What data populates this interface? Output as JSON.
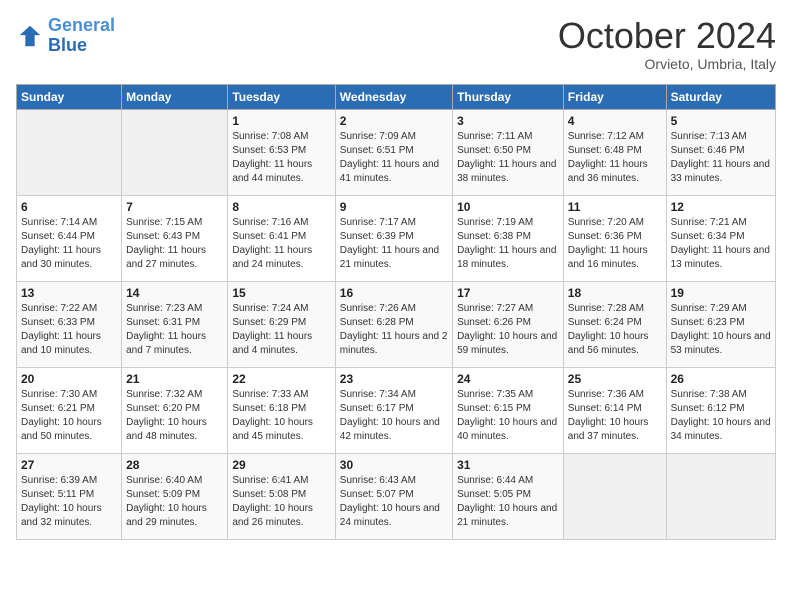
{
  "header": {
    "logo_line1": "General",
    "logo_line2": "Blue",
    "month": "October 2024",
    "location": "Orvieto, Umbria, Italy"
  },
  "weekdays": [
    "Sunday",
    "Monday",
    "Tuesday",
    "Wednesday",
    "Thursday",
    "Friday",
    "Saturday"
  ],
  "weeks": [
    [
      {
        "day": "",
        "info": ""
      },
      {
        "day": "",
        "info": ""
      },
      {
        "day": "1",
        "info": "Sunrise: 7:08 AM\nSunset: 6:53 PM\nDaylight: 11 hours and 44 minutes."
      },
      {
        "day": "2",
        "info": "Sunrise: 7:09 AM\nSunset: 6:51 PM\nDaylight: 11 hours and 41 minutes."
      },
      {
        "day": "3",
        "info": "Sunrise: 7:11 AM\nSunset: 6:50 PM\nDaylight: 11 hours and 38 minutes."
      },
      {
        "day": "4",
        "info": "Sunrise: 7:12 AM\nSunset: 6:48 PM\nDaylight: 11 hours and 36 minutes."
      },
      {
        "day": "5",
        "info": "Sunrise: 7:13 AM\nSunset: 6:46 PM\nDaylight: 11 hours and 33 minutes."
      }
    ],
    [
      {
        "day": "6",
        "info": "Sunrise: 7:14 AM\nSunset: 6:44 PM\nDaylight: 11 hours and 30 minutes."
      },
      {
        "day": "7",
        "info": "Sunrise: 7:15 AM\nSunset: 6:43 PM\nDaylight: 11 hours and 27 minutes."
      },
      {
        "day": "8",
        "info": "Sunrise: 7:16 AM\nSunset: 6:41 PM\nDaylight: 11 hours and 24 minutes."
      },
      {
        "day": "9",
        "info": "Sunrise: 7:17 AM\nSunset: 6:39 PM\nDaylight: 11 hours and 21 minutes."
      },
      {
        "day": "10",
        "info": "Sunrise: 7:19 AM\nSunset: 6:38 PM\nDaylight: 11 hours and 18 minutes."
      },
      {
        "day": "11",
        "info": "Sunrise: 7:20 AM\nSunset: 6:36 PM\nDaylight: 11 hours and 16 minutes."
      },
      {
        "day": "12",
        "info": "Sunrise: 7:21 AM\nSunset: 6:34 PM\nDaylight: 11 hours and 13 minutes."
      }
    ],
    [
      {
        "day": "13",
        "info": "Sunrise: 7:22 AM\nSunset: 6:33 PM\nDaylight: 11 hours and 10 minutes."
      },
      {
        "day": "14",
        "info": "Sunrise: 7:23 AM\nSunset: 6:31 PM\nDaylight: 11 hours and 7 minutes."
      },
      {
        "day": "15",
        "info": "Sunrise: 7:24 AM\nSunset: 6:29 PM\nDaylight: 11 hours and 4 minutes."
      },
      {
        "day": "16",
        "info": "Sunrise: 7:26 AM\nSunset: 6:28 PM\nDaylight: 11 hours and 2 minutes."
      },
      {
        "day": "17",
        "info": "Sunrise: 7:27 AM\nSunset: 6:26 PM\nDaylight: 10 hours and 59 minutes."
      },
      {
        "day": "18",
        "info": "Sunrise: 7:28 AM\nSunset: 6:24 PM\nDaylight: 10 hours and 56 minutes."
      },
      {
        "day": "19",
        "info": "Sunrise: 7:29 AM\nSunset: 6:23 PM\nDaylight: 10 hours and 53 minutes."
      }
    ],
    [
      {
        "day": "20",
        "info": "Sunrise: 7:30 AM\nSunset: 6:21 PM\nDaylight: 10 hours and 50 minutes."
      },
      {
        "day": "21",
        "info": "Sunrise: 7:32 AM\nSunset: 6:20 PM\nDaylight: 10 hours and 48 minutes."
      },
      {
        "day": "22",
        "info": "Sunrise: 7:33 AM\nSunset: 6:18 PM\nDaylight: 10 hours and 45 minutes."
      },
      {
        "day": "23",
        "info": "Sunrise: 7:34 AM\nSunset: 6:17 PM\nDaylight: 10 hours and 42 minutes."
      },
      {
        "day": "24",
        "info": "Sunrise: 7:35 AM\nSunset: 6:15 PM\nDaylight: 10 hours and 40 minutes."
      },
      {
        "day": "25",
        "info": "Sunrise: 7:36 AM\nSunset: 6:14 PM\nDaylight: 10 hours and 37 minutes."
      },
      {
        "day": "26",
        "info": "Sunrise: 7:38 AM\nSunset: 6:12 PM\nDaylight: 10 hours and 34 minutes."
      }
    ],
    [
      {
        "day": "27",
        "info": "Sunrise: 6:39 AM\nSunset: 5:11 PM\nDaylight: 10 hours and 32 minutes."
      },
      {
        "day": "28",
        "info": "Sunrise: 6:40 AM\nSunset: 5:09 PM\nDaylight: 10 hours and 29 minutes."
      },
      {
        "day": "29",
        "info": "Sunrise: 6:41 AM\nSunset: 5:08 PM\nDaylight: 10 hours and 26 minutes."
      },
      {
        "day": "30",
        "info": "Sunrise: 6:43 AM\nSunset: 5:07 PM\nDaylight: 10 hours and 24 minutes."
      },
      {
        "day": "31",
        "info": "Sunrise: 6:44 AM\nSunset: 5:05 PM\nDaylight: 10 hours and 21 minutes."
      },
      {
        "day": "",
        "info": ""
      },
      {
        "day": "",
        "info": ""
      }
    ]
  ]
}
